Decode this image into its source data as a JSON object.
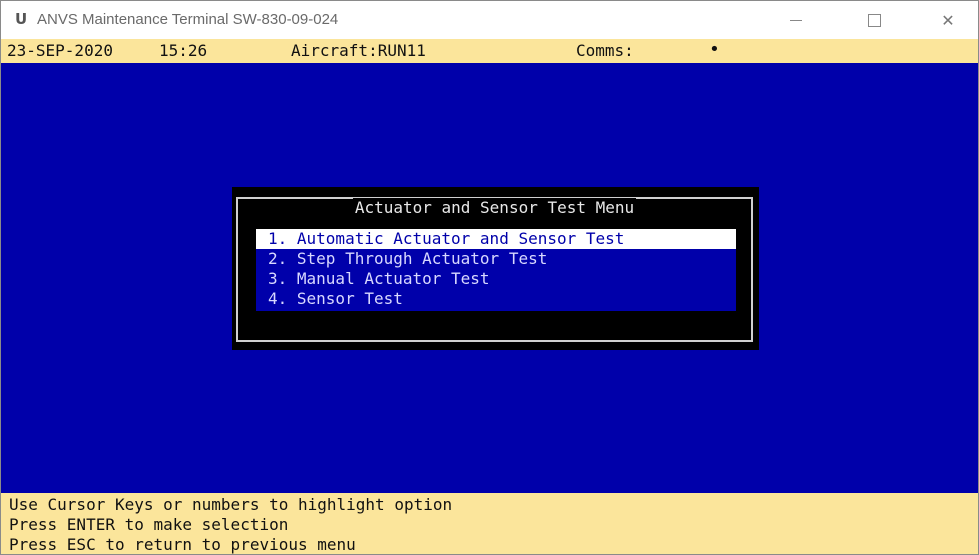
{
  "window": {
    "title": "ANVS Maintenance Terminal SW-830-09-024",
    "icon_glyph": "U",
    "controls": [
      "minimize-icon",
      "maximize-icon",
      "close-icon"
    ],
    "close_glyph": "✕"
  },
  "status": {
    "date": "23-SEP-2020",
    "time": "15:26",
    "aircraft": "Aircraft:RUN11",
    "comms_label": "Comms:",
    "comms_indicator": "•"
  },
  "menu": {
    "title": "Actuator and Sensor Test Menu",
    "selected_index": 0,
    "items": [
      "1. Automatic Actuator and Sensor Test",
      "2. Step Through Actuator Test",
      "3. Manual Actuator Test",
      "4. Sensor Test"
    ]
  },
  "help": {
    "line1": "Use Cursor Keys or numbers to highlight option",
    "line2": "Press ENTER to make selection",
    "line3": "Press ESC to return to previous menu"
  },
  "colors": {
    "screen_bg": "#0000aa",
    "status_bg": "#fbe59b",
    "highlight_bg": "#ffffff",
    "dialog_bg": "#000000"
  }
}
